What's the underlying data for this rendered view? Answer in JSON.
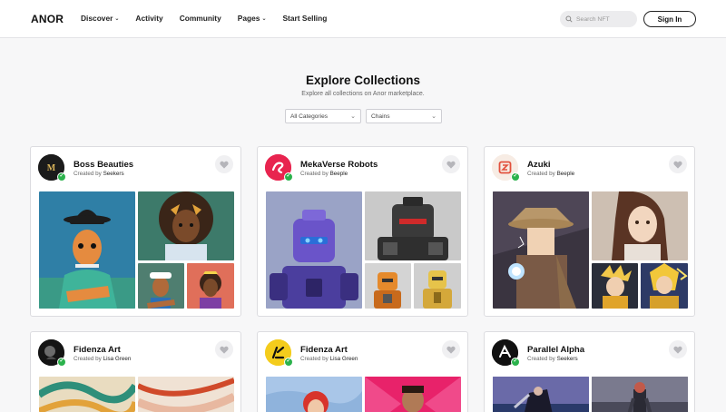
{
  "brand": {
    "logo": "ANOR"
  },
  "nav": [
    {
      "label": "Discover",
      "dropdown": true
    },
    {
      "label": "Activity",
      "dropdown": false
    },
    {
      "label": "Community",
      "dropdown": false
    },
    {
      "label": "Pages",
      "dropdown": true
    },
    {
      "label": "Start Selling",
      "dropdown": false
    }
  ],
  "search": {
    "placeholder": "Search NFT",
    "icon": "search-icon"
  },
  "auth": {
    "sign_in": "Sign In"
  },
  "hero": {
    "title": "Explore Collections",
    "subtitle": "Explore all collections on Anor marketplace."
  },
  "filters": {
    "category": "All Categories",
    "chain": "Chains"
  },
  "created_by_prefix": "Created by",
  "colors": {
    "verified": "#2bb24c",
    "border": "#dcdce0",
    "accent_pink": "#e8244f",
    "accent_yellow": "#f4cc1c"
  },
  "collections": [
    {
      "name": "Boss Beauties",
      "creator": "Seekers"
    },
    {
      "name": "MekaVerse Robots",
      "creator": "Beeple"
    },
    {
      "name": "Azuki",
      "creator": "Beeple"
    },
    {
      "name": "Fidenza Art",
      "creator": "Lisa Green"
    },
    {
      "name": "Fidenza Art",
      "creator": "Lisa Green"
    },
    {
      "name": "Parallel Alpha",
      "creator": "Seekers"
    }
  ]
}
